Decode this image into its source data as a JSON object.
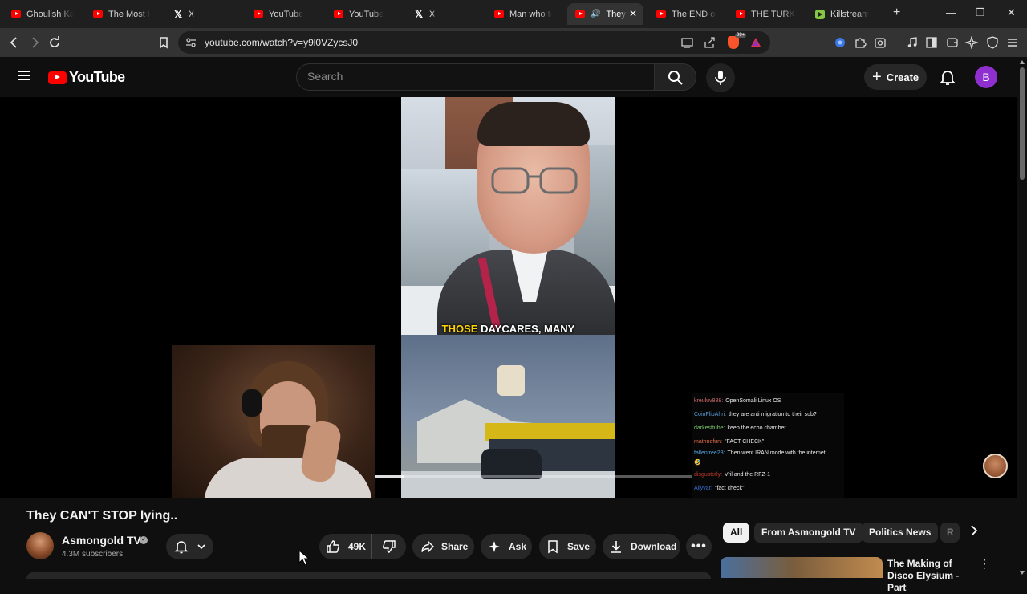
{
  "browser": {
    "tabs": [
      {
        "label": "Ghoulish Kar",
        "icon": "youtube-icon"
      },
      {
        "label": "The Most Ha",
        "icon": "youtube-icon"
      },
      {
        "label": "X",
        "icon": "x-icon"
      },
      {
        "label": "YouTube",
        "icon": "youtube-icon"
      },
      {
        "label": "YouTube",
        "icon": "youtube-icon"
      },
      {
        "label": "X",
        "icon": "x-icon"
      },
      {
        "label": "Man who tau",
        "icon": "youtube-icon"
      },
      {
        "label": "They C",
        "icon": "youtube-icon",
        "active": true,
        "audio": true
      },
      {
        "label": "The END of I",
        "icon": "youtube-icon"
      },
      {
        "label": "THE TURKEY",
        "icon": "youtube-icon"
      },
      {
        "label": "Killstream",
        "icon": "rumble-icon"
      }
    ],
    "url": "youtube.com/watch?v=y9l0VZycsJ0",
    "brave_badge": "99+"
  },
  "header": {
    "logo_text": "YouTube",
    "search_placeholder": "Search",
    "create_label": "Create",
    "avatar_letter": "B"
  },
  "player": {
    "subtitle_highlight": "THOSE",
    "subtitle_rest": " DAYCARES, MANY",
    "progress": 0.09,
    "chat": [
      {
        "user": "kreuluv888:",
        "text": "OpenSomali Linux OS",
        "color": "#d66f6f"
      },
      {
        "user": "CoinFlipAhri:",
        "text": "they are anti migration to their sub?",
        "color": "#5b9bd5"
      },
      {
        "user": "darkesttube:",
        "text": "keep the echo chamber",
        "color": "#7bc96f"
      },
      {
        "user": "mathnofun:",
        "text": "\"FACT CHECK\"",
        "color": "#e06c4a"
      },
      {
        "user": "fallentree23:",
        "text": "Then went IRAN mode with the internet.",
        "color": "#4fa3e0"
      },
      {
        "user": "",
        "text": "🤣",
        "color": "#eaeaea"
      },
      {
        "user": "disgustofly:",
        "text": "Vril and the RFZ-1",
        "color": "#c0392b"
      },
      {
        "user": "Aliyvar:",
        "text": "\"fact check\"",
        "color": "#3b6fd1"
      }
    ]
  },
  "video": {
    "title": "They CAN'T STOP lying..",
    "channel": "Asmongold TV",
    "subscribers": "4.3M subscribers",
    "likes": "49K",
    "actions": {
      "share": "Share",
      "ask": "Ask",
      "save": "Save",
      "download": "Download"
    }
  },
  "recommendations": {
    "chips": [
      "All",
      "From Asmongold TV",
      "Politics News",
      "R"
    ],
    "first_title": "The Making of Disco Elysium - Part"
  },
  "colors": {
    "youtube_red": "#ff0000",
    "background": "#0f0f0f",
    "pill": "#272727",
    "avatar": "#8f2fd0"
  }
}
